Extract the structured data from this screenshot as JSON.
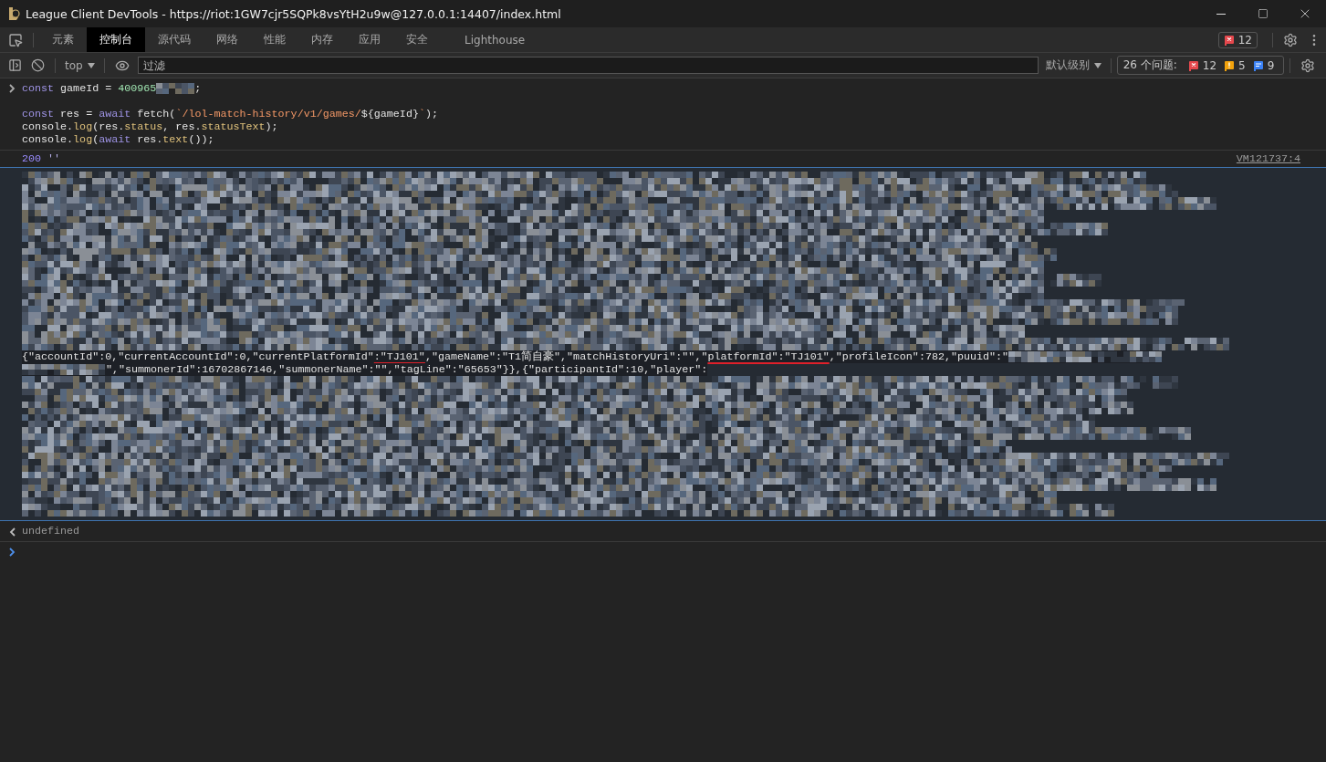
{
  "window": {
    "title": "League Client DevTools - https://riot:1GW7cjr5SQPk8vsYtH2u9w@127.0.0.1:14407/index.html"
  },
  "tabs": [
    {
      "label": "元素",
      "selected": false
    },
    {
      "label": "控制台",
      "selected": true
    },
    {
      "label": "源代码",
      "selected": false
    },
    {
      "label": "网络",
      "selected": false
    },
    {
      "label": "性能",
      "selected": false
    },
    {
      "label": "内存",
      "selected": false
    },
    {
      "label": "应用",
      "selected": false
    },
    {
      "label": "安全",
      "selected": false
    },
    {
      "label": "Lighthouse",
      "selected": false
    }
  ],
  "issue_badge": {
    "count": "12"
  },
  "console_toolbar": {
    "context": "top",
    "filter": {
      "placeholder": "过滤"
    },
    "levels": "默认级别",
    "issues": {
      "label": "26 个问题:",
      "counts": [
        {
          "kind": "error",
          "count": "12"
        },
        {
          "kind": "warning",
          "count": "5"
        },
        {
          "kind": "info",
          "count": "9"
        }
      ]
    }
  },
  "console": {
    "input_blocks": [
      [
        [
          {
            "kind": "keyword",
            "text": "const"
          },
          {
            "kind": "plain",
            "text": " gameId = "
          },
          {
            "kind": "number",
            "text": "400965"
          },
          {
            "kind": "redacted"
          },
          {
            "kind": "plain",
            "text": ";"
          }
        ]
      ],
      [
        [
          {
            "kind": "keyword",
            "text": "const"
          },
          {
            "kind": "plain",
            "text": " res = "
          },
          {
            "kind": "keyword",
            "text": "await"
          },
          {
            "kind": "plain",
            "text": " fetch("
          },
          {
            "kind": "string",
            "text": "`/lol-match-history/v1/games/"
          },
          {
            "kind": "plain",
            "text": "${gameId}"
          },
          {
            "kind": "string",
            "text": "`"
          },
          {
            "kind": "plain",
            "text": ");"
          }
        ],
        [
          {
            "kind": "plain",
            "text": "console."
          },
          {
            "kind": "method",
            "text": "log"
          },
          {
            "kind": "plain",
            "text": "(res."
          },
          {
            "kind": "method",
            "text": "status"
          },
          {
            "kind": "plain",
            "text": ", res."
          },
          {
            "kind": "method",
            "text": "statusText"
          },
          {
            "kind": "plain",
            "text": ");"
          }
        ],
        [
          {
            "kind": "plain",
            "text": "console."
          },
          {
            "kind": "method",
            "text": "log"
          },
          {
            "kind": "plain",
            "text": "("
          },
          {
            "kind": "keyword",
            "text": "await"
          },
          {
            "kind": "plain",
            "text": " res."
          },
          {
            "kind": "method",
            "text": "text"
          },
          {
            "kind": "plain",
            "text": "());"
          }
        ]
      ]
    ],
    "log": {
      "status": "200",
      "status_text": "''",
      "source": "VM121737:4"
    },
    "output_lines": [
      [
        {
          "kind": "plain",
          "text": "{\"accountId\":0,\"currentAccountId\":0,\"currentPlatformId\""
        },
        {
          "kind": "marked",
          "text": ":\"TJ101\""
        },
        {
          "kind": "plain",
          "text": ",\"gameName\":\"T1简自豪\",\"matchHistoryUri\":\"\",\""
        },
        {
          "kind": "marked",
          "text": "platformId\":\"TJ101\""
        },
        {
          "kind": "plain",
          "text": ",\"profileIcon\":782,\"puuid\":\""
        },
        {
          "kind": "redacted"
        }
      ],
      [
        {
          "kind": "redacted"
        },
        {
          "kind": "plain",
          "text": "\",\"summonerId\":16702867146,\"summonerName\":\"\",\"tagLine\":\"65653\"}},{\"participantId\":10,\"player\":"
        }
      ]
    ],
    "result": "undefined"
  }
}
